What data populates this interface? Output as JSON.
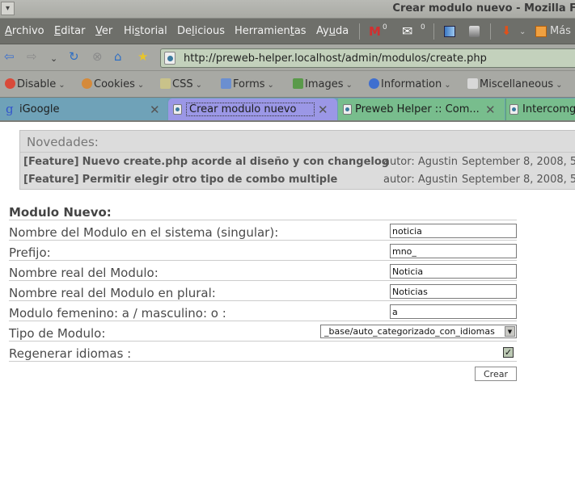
{
  "window": {
    "title": "Crear modulo nuevo - Mozilla Firefox",
    "title_visible": "Crear modulo nuevo - Mozilla F"
  },
  "menubar": {
    "items": [
      {
        "label": "Archivo",
        "accel": "A"
      },
      {
        "label": "Editar",
        "accel": "E"
      },
      {
        "label": "Ver",
        "accel": "V"
      },
      {
        "label": "Historial",
        "accel": "s"
      },
      {
        "label": "Delicious",
        "accel": "l"
      },
      {
        "label": "Herramientas",
        "accel": "t"
      },
      {
        "label": "Ayuda",
        "accel": "u"
      }
    ],
    "gmail_count": "0",
    "mail_count": "0",
    "more_label": "Más"
  },
  "navbar": {
    "url": "http://preweb-helper.localhost/admin/modulos/create.php"
  },
  "devbar": {
    "items": [
      {
        "label": "Disable",
        "icon": "disable-icon",
        "color": "#d94a3a"
      },
      {
        "label": "Cookies",
        "icon": "cookies-icon",
        "color": "#d58a3a"
      },
      {
        "label": "CSS",
        "icon": "css-icon",
        "color": "#c9c28a"
      },
      {
        "label": "Forms",
        "icon": "forms-icon",
        "color": "#6b8fd0"
      },
      {
        "label": "Images",
        "icon": "images-icon",
        "color": "#5a9a4a"
      },
      {
        "label": "Information",
        "icon": "information-icon",
        "color": "#3f6fcf"
      },
      {
        "label": "Miscellaneous",
        "icon": "miscellaneous-icon",
        "color": "#d8d8d8"
      }
    ]
  },
  "tabs": [
    {
      "label": "iGoogle",
      "active": false
    },
    {
      "label": "Crear modulo nuevo",
      "active": true
    },
    {
      "label": "Preweb Helper :: Com...",
      "active": false
    },
    {
      "label": "Intercomg",
      "active": false
    }
  ],
  "news": {
    "heading": "Novedades:",
    "items": [
      {
        "tag": "[Feature]",
        "title": "Nuevo create.php acorde al diseño y con changelog",
        "author": "autor: Agustin",
        "date": "September 8, 2008, 5:"
      },
      {
        "tag": "[Feature]",
        "title": "Permitir elegir otro tipo de combo multiple",
        "author": "autor: Agustin",
        "date": "September 8, 2008, 5:"
      }
    ]
  },
  "form": {
    "title": "Modulo Nuevo:",
    "fields": [
      {
        "label": "Nombre del Modulo en el sistema (singular):",
        "value": "noticia"
      },
      {
        "label": "Prefijo:",
        "value": "mno_"
      },
      {
        "label": "Nombre real del Modulo:",
        "value": "Noticia"
      },
      {
        "label": "Nombre real del Modulo en plural:",
        "value": "Noticias"
      },
      {
        "label": "Modulo femenino: a / masculino: o :",
        "value": "a"
      }
    ],
    "type_label": "Tipo de Modulo:",
    "type_value": "_base/auto_categorizado_con_idiomas",
    "regen_label": "Regenerar idiomas :",
    "regen_checked": true,
    "submit_label": "Crear"
  }
}
